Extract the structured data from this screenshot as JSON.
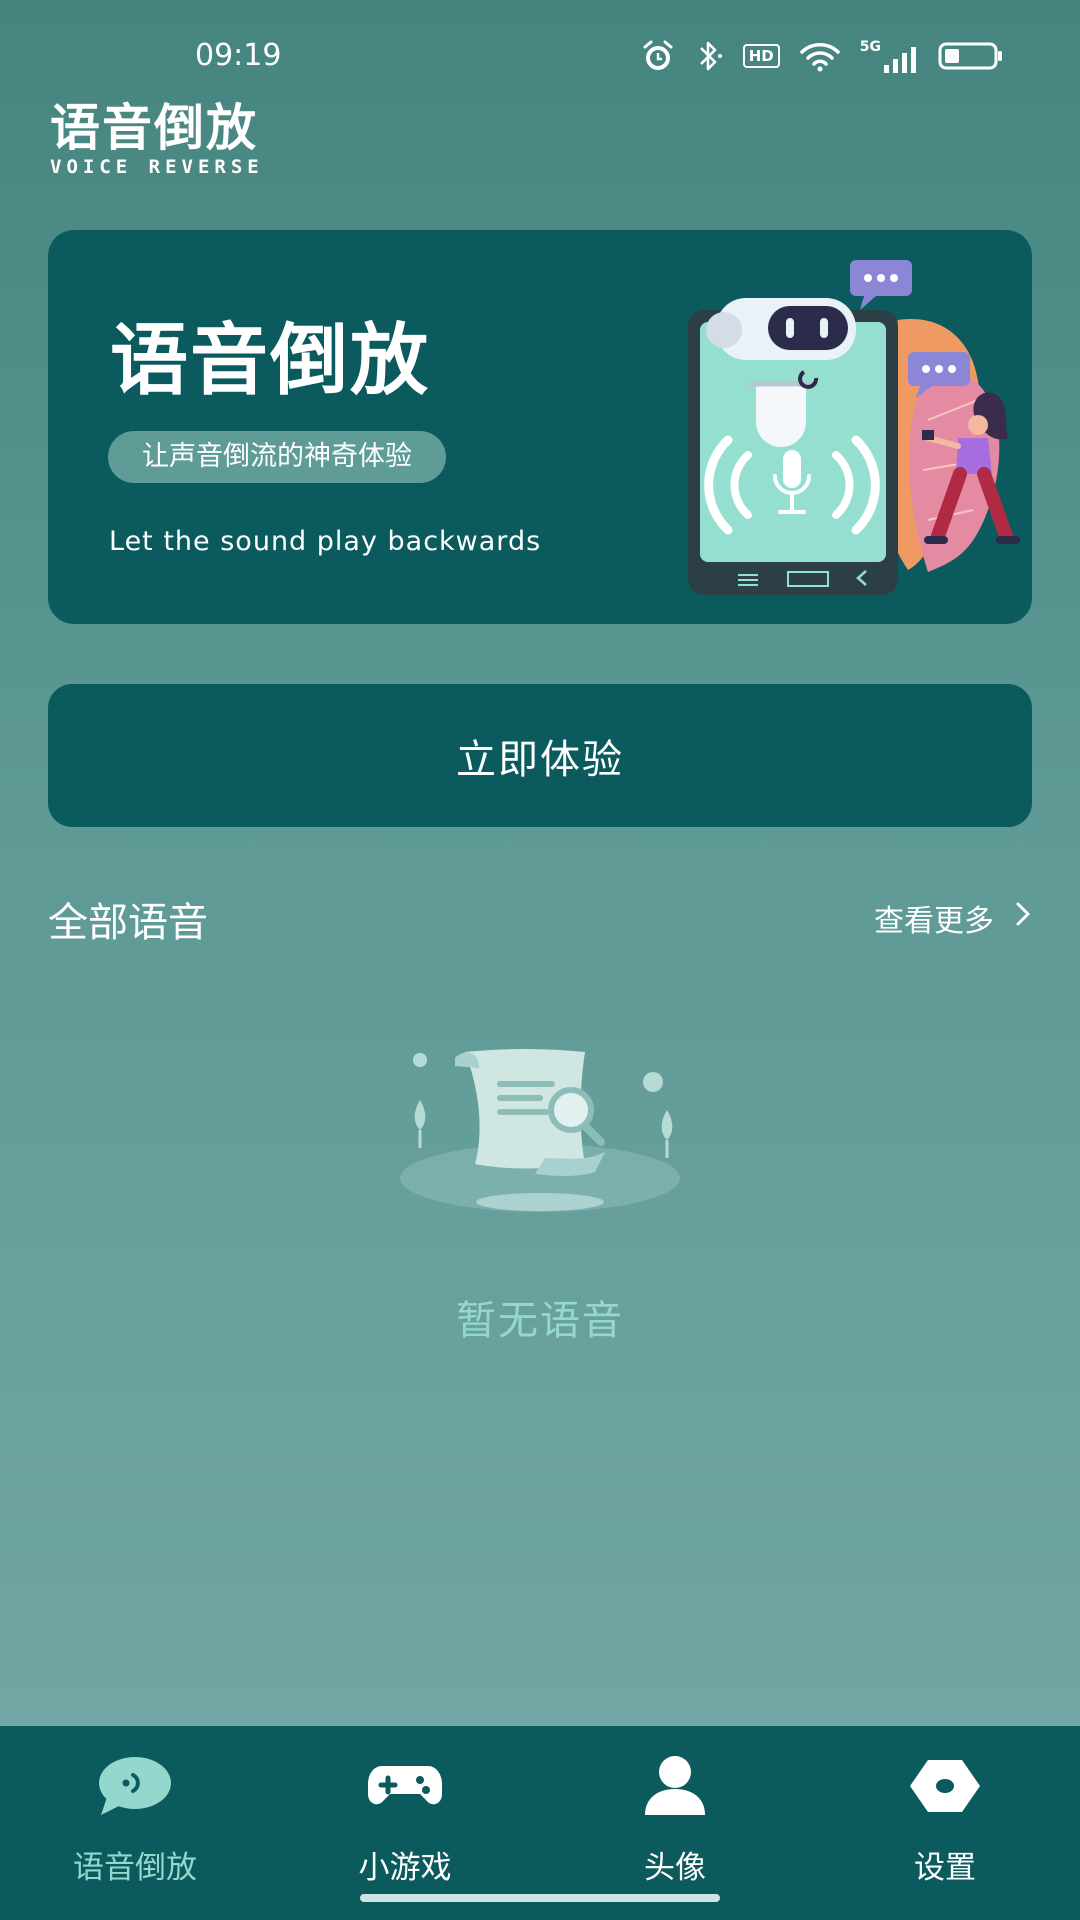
{
  "status_bar": {
    "time": "09:19",
    "icons": [
      "alarm-icon",
      "bluetooth-icon",
      "hd-icon",
      "wifi-icon",
      "signal-5g-icon",
      "battery-icon"
    ],
    "hd_label": "HD",
    "network_label": "5G"
  },
  "header": {
    "title": "语音倒放",
    "subtitle": "VOICE REVERSE"
  },
  "banner": {
    "title": "语音倒放",
    "tagline": "让声音倒流的神奇体验",
    "caption": "Let the sound play backwards"
  },
  "cta": {
    "label": "立即体验"
  },
  "section": {
    "title": "全部语音",
    "more_label": "查看更多"
  },
  "empty_state": {
    "text": "暂无语音"
  },
  "bottom_nav": {
    "items": [
      {
        "label": "语音倒放",
        "icon": "chat-bubble-icon",
        "active": true
      },
      {
        "label": "小游戏",
        "icon": "gamepad-icon",
        "active": false
      },
      {
        "label": "头像",
        "icon": "user-icon",
        "active": false
      },
      {
        "label": "设置",
        "icon": "settings-hexagon-icon",
        "active": false
      }
    ]
  },
  "colors": {
    "background_top": "#45847f",
    "background_bottom": "#74a9a7",
    "card": "#0b5a5e",
    "accent": "#93d7cd"
  }
}
